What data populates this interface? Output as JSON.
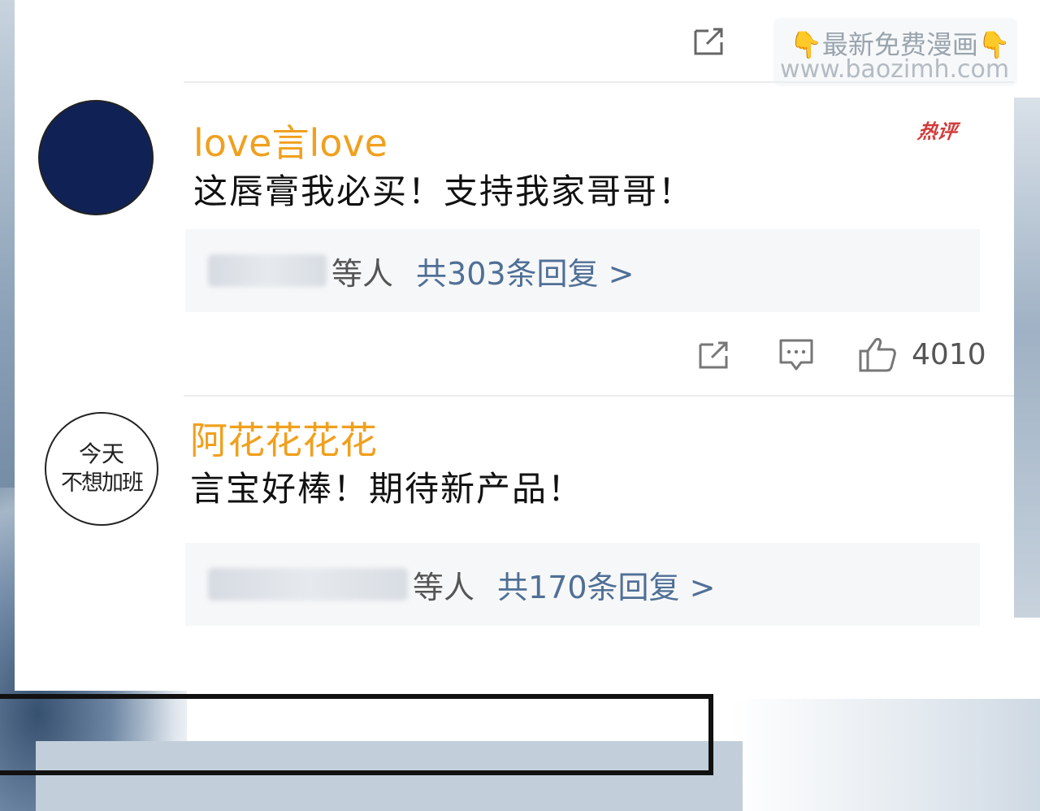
{
  "watermark": {
    "line1": "最新免费漫画",
    "line2": "www.baozimh.com",
    "hand_icon": "pointing-down-hand"
  },
  "comments": [
    {
      "username": "love言love",
      "text": "这唇膏我必买！支持我家哥哥！",
      "badge": "热评",
      "reply_suffix": "等人",
      "reply_count": "共303条回复 >",
      "likes": "4010",
      "avatar_color": "#102255"
    },
    {
      "username": "阿花花花花",
      "text": "言宝好棒！期待新产品！",
      "avatar_line1": "今天",
      "avatar_line2": "不想加班",
      "reply_suffix": "等人",
      "reply_count": "共170条回复 >"
    }
  ],
  "colors": {
    "username": "#f0a01e",
    "reply_link": "#4f6f96",
    "hot_badge": "#d23a3a"
  }
}
